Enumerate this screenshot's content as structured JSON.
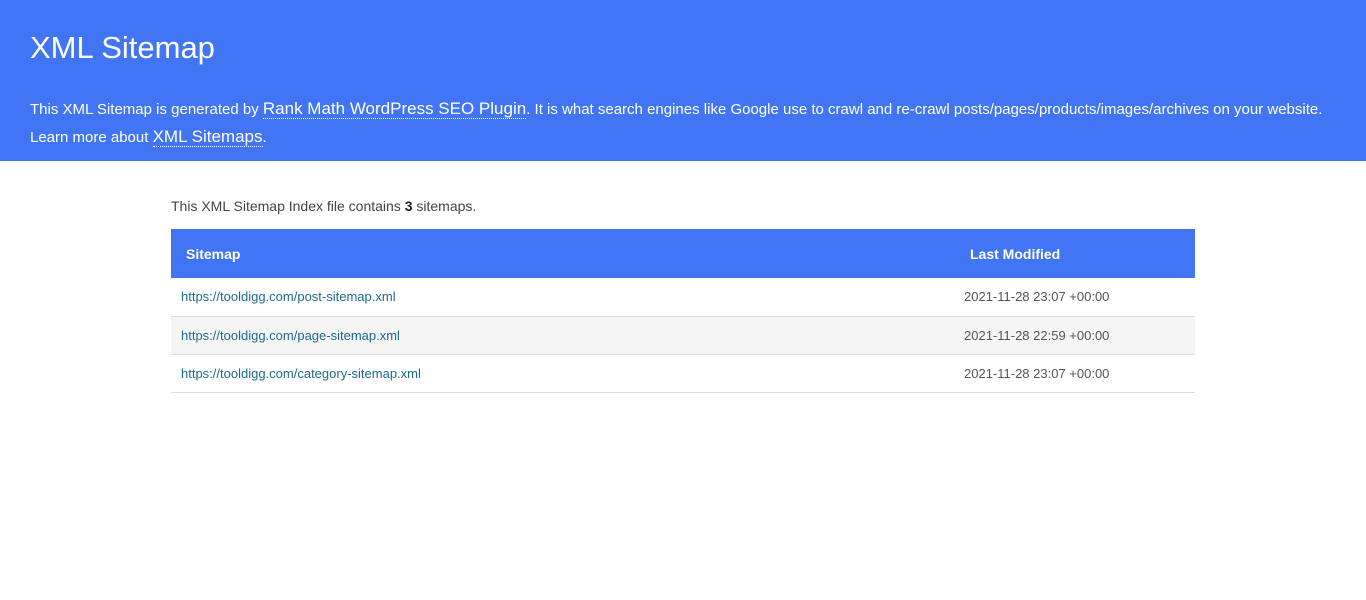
{
  "header": {
    "title": "XML Sitemap",
    "intro_prefix": "This XML Sitemap is generated by ",
    "plugin_link": "Rank Math WordPress SEO Plugin",
    "intro_mid": ". It is what search engines like Google use to crawl and re-crawl posts/pages/products/images/archives on your website. Learn more about ",
    "sitemaps_link": "XML Sitemaps",
    "intro_suffix": "."
  },
  "summary": {
    "prefix": "This XML Sitemap Index file contains ",
    "count": "3",
    "suffix": " sitemaps."
  },
  "table": {
    "headers": {
      "sitemap": "Sitemap",
      "last_modified": "Last Modified"
    },
    "rows": [
      {
        "url": "https://tooldigg.com/post-sitemap.xml",
        "modified": "2021-11-28 23:07 +00:00"
      },
      {
        "url": "https://tooldigg.com/page-sitemap.xml",
        "modified": "2021-11-28 22:59 +00:00"
      },
      {
        "url": "https://tooldigg.com/category-sitemap.xml",
        "modified": "2021-11-28 23:07 +00:00"
      }
    ]
  },
  "colors": {
    "header_bg": "#4275f4",
    "link": "#1d6b8a",
    "alt_row": "#f5f5f5"
  }
}
